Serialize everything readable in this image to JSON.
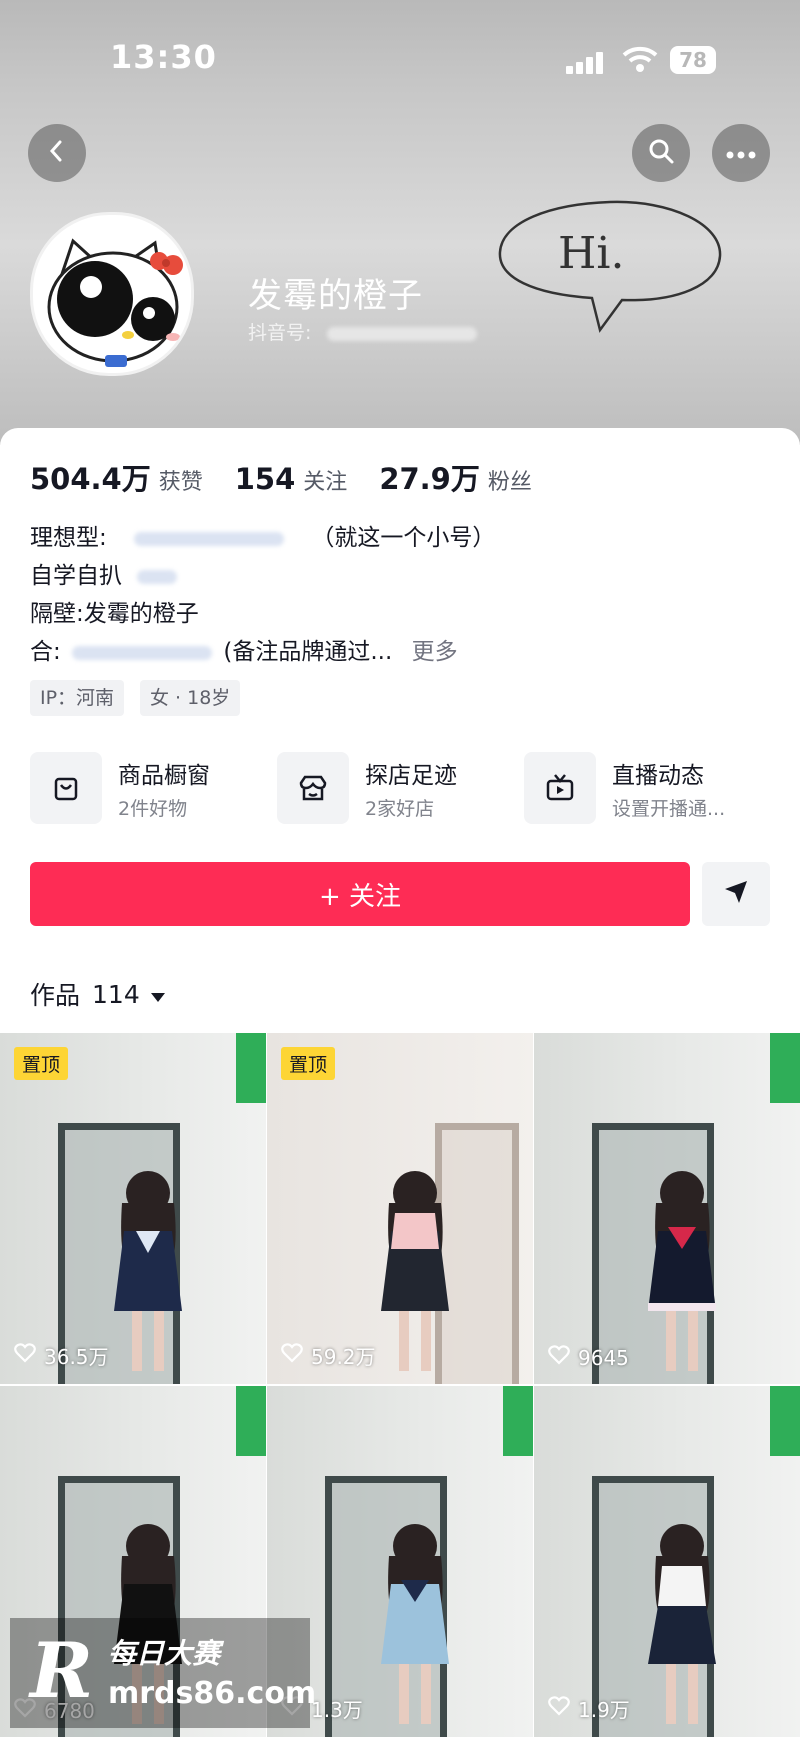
{
  "status_bar": {
    "time": "13:30",
    "battery": "78"
  },
  "header": {
    "back_icon": "chevron-left-icon",
    "search_icon": "search-icon",
    "more_icon": "more-dots-icon"
  },
  "profile": {
    "name": "发霉的橙子",
    "douyin_id_label": "抖音号:",
    "banner_text": "Hi."
  },
  "stats": [
    {
      "value": "504.4万",
      "label": "获赞"
    },
    {
      "value": "154",
      "label": "关注"
    },
    {
      "value": "27.9万",
      "label": "粉丝"
    }
  ],
  "bio": {
    "line1_prefix": "理想型:",
    "line1_suffix": "（就这一个小号）",
    "line2": "自学自扒",
    "line3": "隔壁:发霉的橙子",
    "line4_prefix": "合:",
    "line4_suffix": "(备注品牌通过...",
    "more": "更多"
  },
  "tags": [
    "IP：河南",
    "女 · 18岁"
  ],
  "services": [
    {
      "title": "商品橱窗",
      "subtitle": "2件好物",
      "icon": "shopping-bag-icon"
    },
    {
      "title": "探店足迹",
      "subtitle": "2家好店",
      "icon": "store-icon"
    },
    {
      "title": "直播动态",
      "subtitle": "设置开播通...",
      "icon": "tv-icon"
    }
  ],
  "actions": {
    "follow": "+ 关注",
    "share_icon": "send-icon"
  },
  "works": {
    "label": "作品",
    "count": "114"
  },
  "videos": [
    {
      "pinned": "置顶",
      "likes": "36.5万"
    },
    {
      "pinned": "置顶",
      "likes": "59.2万"
    },
    {
      "pinned": "",
      "likes": "9645"
    },
    {
      "pinned": "",
      "likes": "6780"
    },
    {
      "pinned": "",
      "likes": "1.3万"
    },
    {
      "pinned": "",
      "likes": "1.9万"
    }
  ],
  "watermark": {
    "logo": "R",
    "name": "每日大赛",
    "url": "mrds86.com"
  },
  "colors": {
    "primary": "#fe2c55",
    "pin_badge": "#fdd535",
    "text": "#161823"
  }
}
